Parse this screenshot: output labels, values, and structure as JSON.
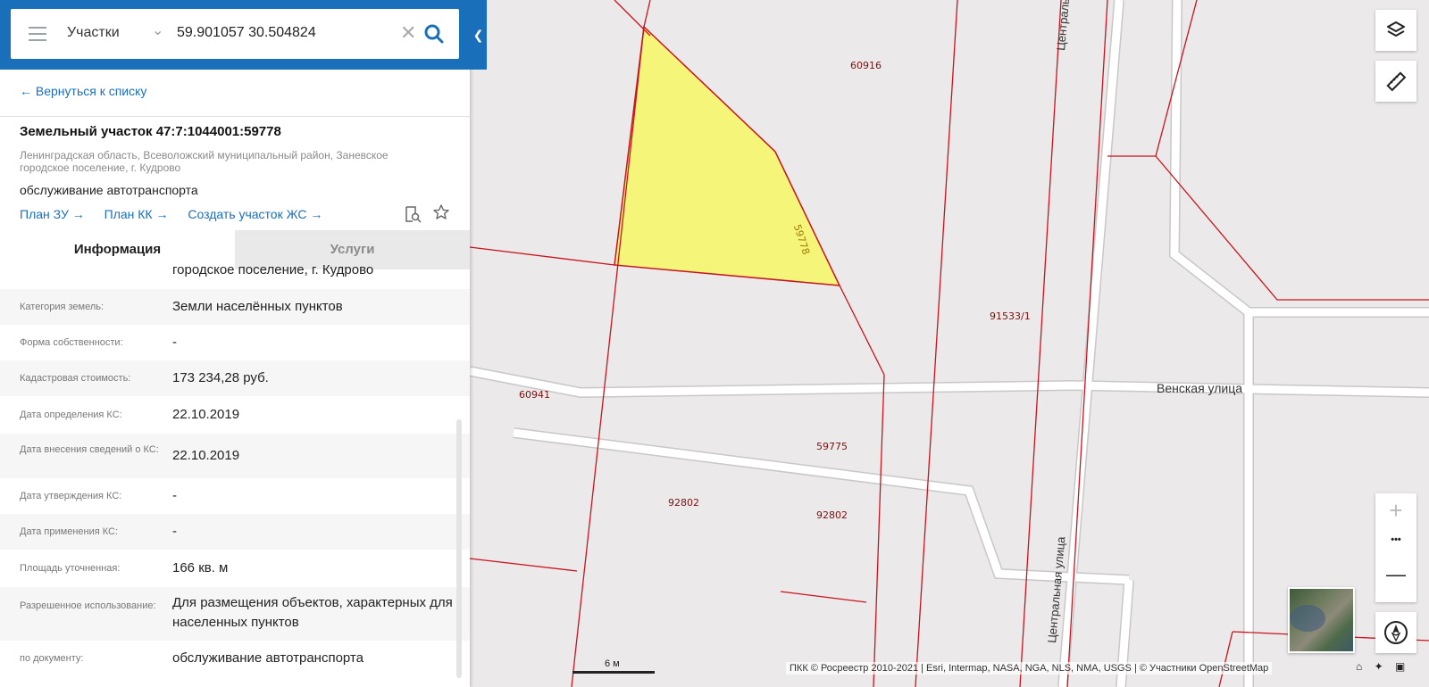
{
  "search": {
    "layer_select": "Участки",
    "query": "59.901057 30.504824",
    "clear_glyph": "✕"
  },
  "panel": {
    "back_link": "← Вернуться к списку",
    "title": "Земельный участок 47:7:1044001:59778",
    "address": "Ленинградская область, Всеволожский муниципальный район, Заневское городское поселение, г. Кудрово",
    "use": "обслуживание автотранспорта",
    "links": [
      "План ЗУ →",
      "План КК →",
      "Создать участок ЖС →"
    ],
    "tabs": {
      "info": "Информация",
      "services": "Услуги"
    },
    "partial_row": "городское поселение, г. Кудрово",
    "rows": [
      {
        "key": "Категория земель:",
        "value": "Земли населённых пунктов"
      },
      {
        "key": "Форма собственности:",
        "value": "-"
      },
      {
        "key": "Кадастровая стоимость:",
        "value": "173 234,28 руб."
      },
      {
        "key": "Дата определения КС:",
        "value": "22.10.2019"
      },
      {
        "key": "Дата внесения сведений о КС:",
        "value": "22.10.2019"
      },
      {
        "key": "Дата утверждения КС:",
        "value": "-"
      },
      {
        "key": "Дата применения КС:",
        "value": "-"
      },
      {
        "key": "Площадь уточненная:",
        "value": "166 кв. м"
      },
      {
        "key": "Разрешенное использование:",
        "value": "Для размещения объектов, характерных для населенных пунктов"
      },
      {
        "key": "по документу:",
        "value": "обслуживание автотранспорта"
      }
    ]
  },
  "map": {
    "plot_labels": [
      {
        "text": "60916"
      },
      {
        "text": "59778"
      },
      {
        "text": "91533/1"
      },
      {
        "text": "60941"
      },
      {
        "text": "59775"
      },
      {
        "text": "92802"
      },
      {
        "text": "92802"
      }
    ],
    "streets": [
      "Центральная улица",
      "Венская улица",
      "Центральная улица"
    ],
    "scale_label": "6 м",
    "attribution": "ПКК © Росреестр 2010-2021 | Esri, Intermap, NASA, NGA, NLS, NMA, USGS | © Участники OpenStreetMap",
    "zoom_in": "+",
    "zoom_more": "•••",
    "zoom_out": "—",
    "highlight_color": "#f5f57a",
    "boundary_color": "#c8141e"
  },
  "icons": {
    "menu": "menu-icon",
    "search": "search-icon",
    "layers": "layers-icon",
    "ruler": "ruler-icon",
    "compass": "compass-icon",
    "home": "home-icon",
    "locate": "locate-icon",
    "fullscreen": "fullscreen-icon"
  }
}
